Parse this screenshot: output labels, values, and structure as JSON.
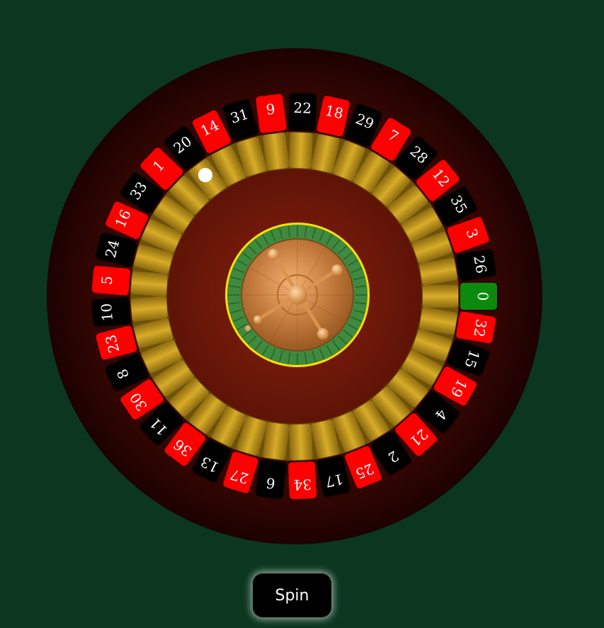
{
  "wheel": {
    "pockets": [
      {
        "number": "0",
        "color": "green"
      },
      {
        "number": "32",
        "color": "red"
      },
      {
        "number": "15",
        "color": "black"
      },
      {
        "number": "19",
        "color": "red"
      },
      {
        "number": "4",
        "color": "black"
      },
      {
        "number": "21",
        "color": "red"
      },
      {
        "number": "2",
        "color": "black"
      },
      {
        "number": "25",
        "color": "red"
      },
      {
        "number": "17",
        "color": "black"
      },
      {
        "number": "34",
        "color": "red"
      },
      {
        "number": "6",
        "color": "black"
      },
      {
        "number": "27",
        "color": "red"
      },
      {
        "number": "13",
        "color": "black"
      },
      {
        "number": "36",
        "color": "red"
      },
      {
        "number": "11",
        "color": "black"
      },
      {
        "number": "30",
        "color": "red"
      },
      {
        "number": "8",
        "color": "black"
      },
      {
        "number": "23",
        "color": "red"
      },
      {
        "number": "10",
        "color": "black"
      },
      {
        "number": "5",
        "color": "red"
      },
      {
        "number": "24",
        "color": "black"
      },
      {
        "number": "16",
        "color": "red"
      },
      {
        "number": "33",
        "color": "black"
      },
      {
        "number": "1",
        "color": "red"
      },
      {
        "number": "20",
        "color": "black"
      },
      {
        "number": "14",
        "color": "red"
      },
      {
        "number": "31",
        "color": "black"
      },
      {
        "number": "9",
        "color": "red"
      },
      {
        "number": "22",
        "color": "black"
      },
      {
        "number": "18",
        "color": "red"
      },
      {
        "number": "29",
        "color": "black"
      },
      {
        "number": "7",
        "color": "red"
      },
      {
        "number": "28",
        "color": "black"
      },
      {
        "number": "12",
        "color": "red"
      },
      {
        "number": "35",
        "color": "black"
      },
      {
        "number": "3",
        "color": "red"
      },
      {
        "number": "26",
        "color": "black"
      }
    ],
    "colors": {
      "background": "#0b3720",
      "rim": "#4a0a04",
      "red": "#ff0000",
      "black": "#000000",
      "green": "#0f8a0f",
      "gold": "#c9a01e",
      "bowl": "#6e1a08",
      "hub_ring": "#ffe000",
      "hub_green": "#4fa04f",
      "hub_copper": "#c8834a"
    }
  },
  "controls": {
    "spin_label": "Spin"
  }
}
